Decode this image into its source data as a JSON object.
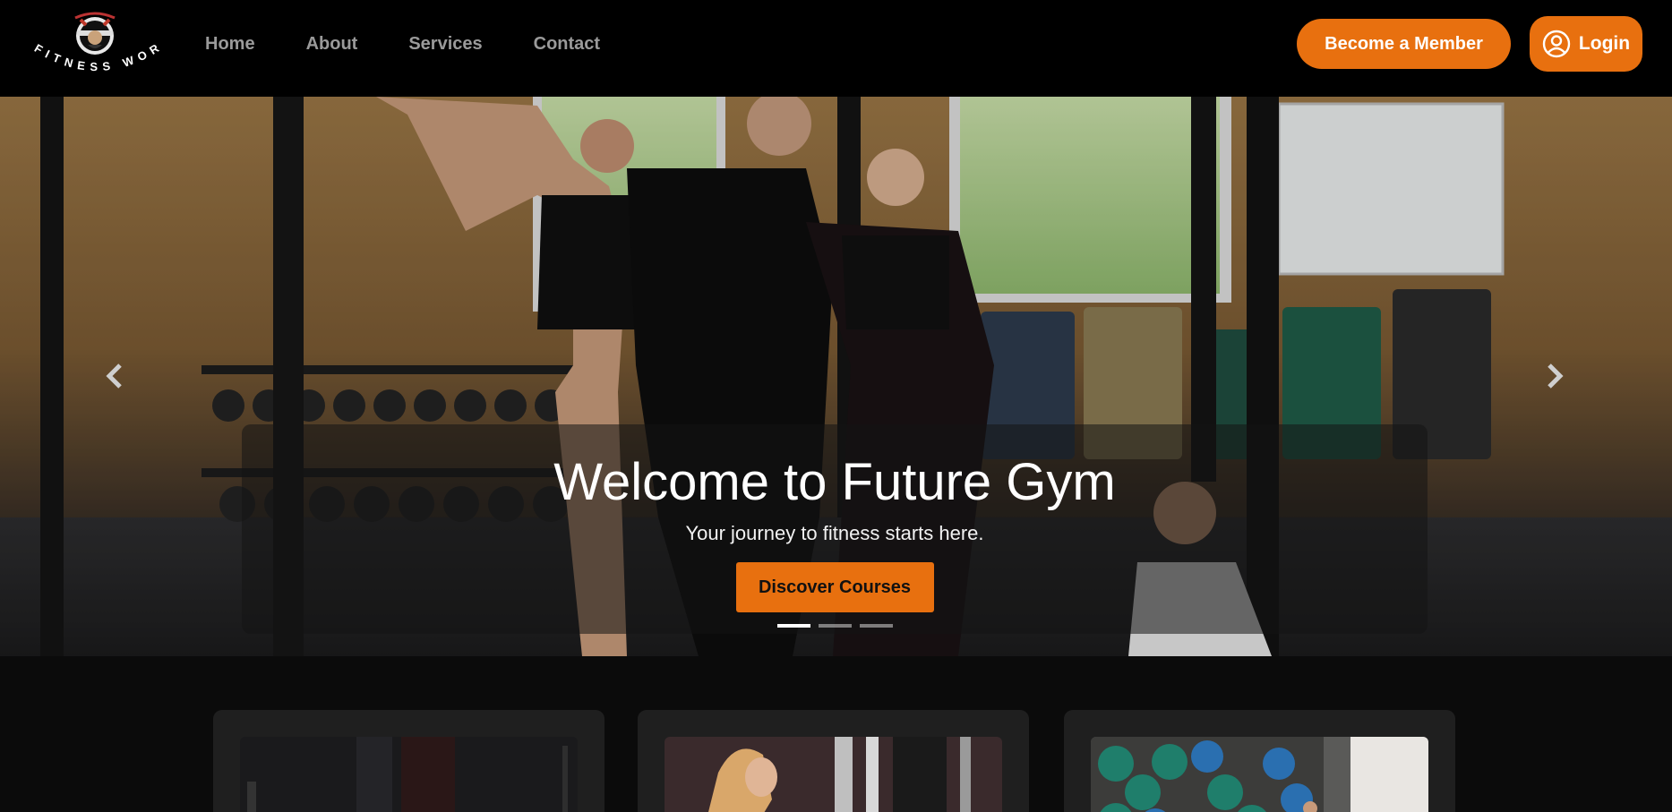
{
  "brand": {
    "name": "FITNESS WORLD"
  },
  "nav": {
    "links": [
      {
        "label": "Home"
      },
      {
        "label": "About"
      },
      {
        "label": "Services"
      },
      {
        "label": "Contact"
      }
    ],
    "member_button": "Become a Member",
    "login_button": "Login",
    "login_icon": "user-circle-icon"
  },
  "hero": {
    "title": "Welcome to Future Gym",
    "subtitle": "Your journey to fitness starts here.",
    "cta": "Discover Courses",
    "prev_icon": "chevron-left-icon",
    "next_icon": "chevron-right-icon",
    "slides_count": 3,
    "active_slide": 1
  },
  "cards": [
    {
      "image": "gym-equipment-dark"
    },
    {
      "image": "woman-workout"
    },
    {
      "image": "exercise-balls-class"
    }
  ],
  "colors": {
    "accent": "#e8700f",
    "navbar_bg": "#000000",
    "nav_link": "#9a9a9a",
    "page_bg": "#0b0b0b",
    "card_bg": "#1f1f1f"
  }
}
